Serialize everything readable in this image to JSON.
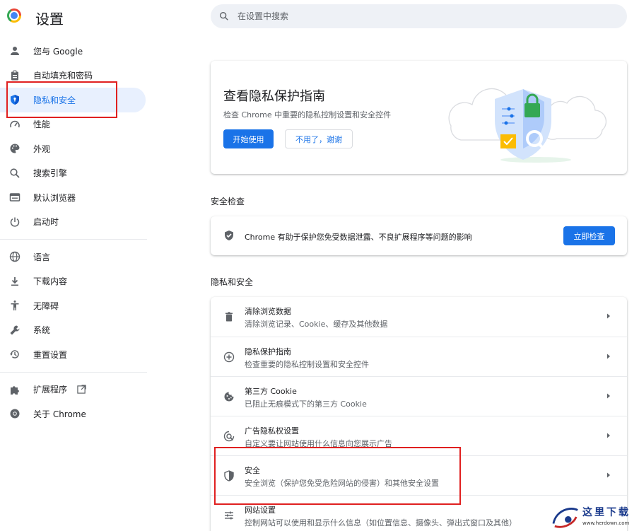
{
  "header": {
    "title": "设置",
    "search_placeholder": "在设置中搜索"
  },
  "sidebar": {
    "items": [
      {
        "label": "您与 Google",
        "icon": "person-icon"
      },
      {
        "label": "自动填充和密码",
        "icon": "clipboard-icon"
      },
      {
        "label": "隐私和安全",
        "icon": "shield-icon",
        "active": true
      },
      {
        "label": "性能",
        "icon": "speedometer-icon"
      },
      {
        "label": "外观",
        "icon": "palette-icon"
      },
      {
        "label": "搜索引擎",
        "icon": "search-icon"
      },
      {
        "label": "默认浏览器",
        "icon": "browser-icon"
      },
      {
        "label": "启动时",
        "icon": "power-icon"
      },
      {
        "label": "语言",
        "icon": "globe-icon"
      },
      {
        "label": "下载内容",
        "icon": "download-icon"
      },
      {
        "label": "无障碍",
        "icon": "accessibility-icon"
      },
      {
        "label": "系统",
        "icon": "wrench-icon"
      },
      {
        "label": "重置设置",
        "icon": "history-icon"
      },
      {
        "label": "扩展程序",
        "icon": "puzzle-icon"
      },
      {
        "label": "关于 Chrome",
        "icon": "chrome-icon"
      }
    ]
  },
  "promo": {
    "title": "查看隐私保护指南",
    "subtitle": "检查 Chrome 中重要的隐私控制设置和安全控件",
    "start_label": "开始使用",
    "dismiss_label": "不用了，谢谢"
  },
  "safety_check": {
    "section_title": "安全检查",
    "text": "Chrome 有助于保护您免受数据泄露、不良扩展程序等问题的影响",
    "button_label": "立即检查"
  },
  "privacy": {
    "section_title": "隐私和安全",
    "rows": [
      {
        "title": "清除浏览数据",
        "subtitle": "清除浏览记录、Cookie、缓存及其他数据",
        "icon": "trash-icon"
      },
      {
        "title": "隐私保护指南",
        "subtitle": "检查重要的隐私控制设置和安全控件",
        "icon": "compass-plus-icon"
      },
      {
        "title": "第三方 Cookie",
        "subtitle": "已阻止无痕模式下的第三方 Cookie",
        "icon": "cookie-icon"
      },
      {
        "title": "广告隐私权设置",
        "subtitle": "自定义要让网站使用什么信息向您展示广告",
        "icon": "ad-privacy-icon"
      },
      {
        "title": "安全",
        "subtitle": "安全浏览（保护您免受危险网站的侵害）和其他安全设置",
        "icon": "security-shield-icon"
      },
      {
        "title": "网站设置",
        "subtitle": "控制网站可以使用和显示什么信息（如位置信息、摄像头、弹出式窗口及其他）",
        "icon": "sliders-icon"
      }
    ]
  },
  "watermark": {
    "text": "这里下载",
    "url": "www.herdown.com"
  },
  "colors": {
    "accent": "#1a73e8",
    "active_bg": "#e8f0fe",
    "highlight_box": "#e02020"
  }
}
